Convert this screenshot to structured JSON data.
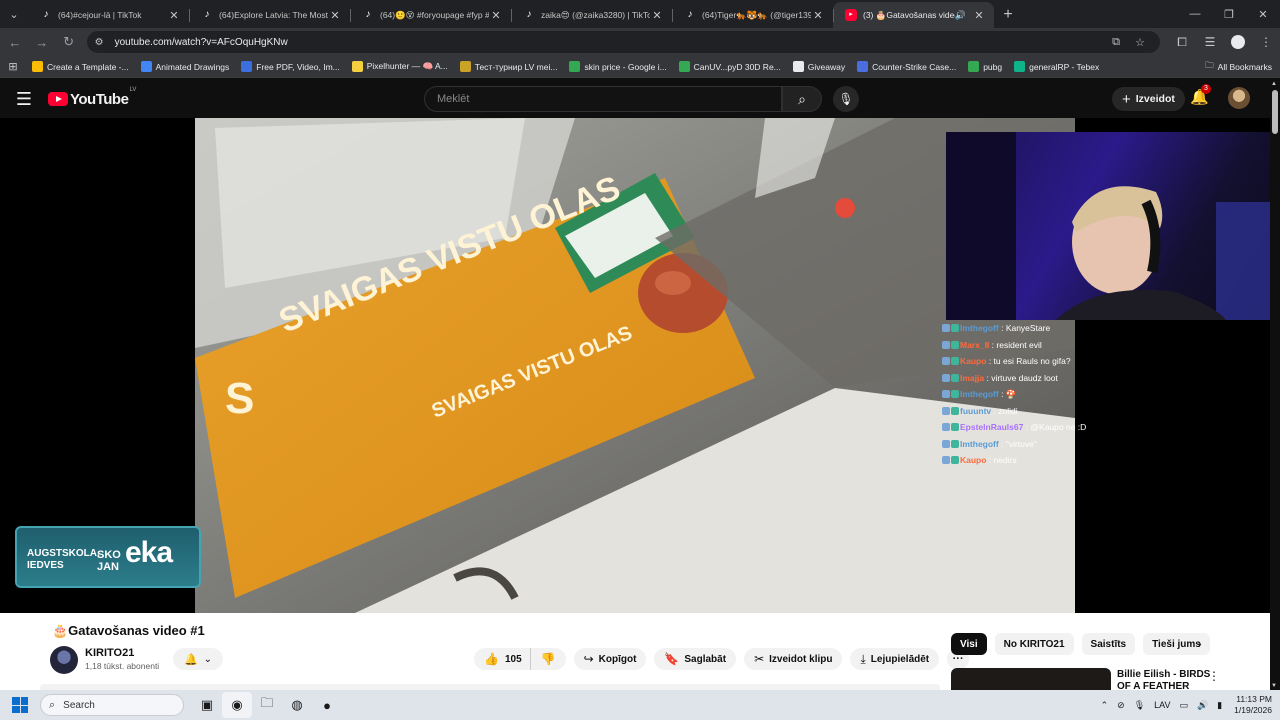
{
  "browser": {
    "tabs": [
      {
        "title": "(64)#cejour-lā | TikTok",
        "icon": "tiktok-icon",
        "active": false
      },
      {
        "title": "(64)Explore Latvia: The Most Te",
        "icon": "tiktok-icon",
        "active": false
      },
      {
        "title": "(64)🙂😵 #foryoupage #fyp #",
        "icon": "tiktok-icon",
        "active": false
      },
      {
        "title": "zaika😍 (@zaika3280) | TikTok",
        "icon": "tiktok-icon",
        "active": false
      },
      {
        "title": "(64)Tiger🐅🐯🐅 (@tiger139",
        "icon": "tiktok-icon",
        "active": false
      },
      {
        "title": "(3) 🎂Gatavošanas video #",
        "icon": "youtube-icon",
        "active": true
      }
    ],
    "url": "youtube.com/watch?v=AFcOquHgKNw",
    "bookmarks": [
      {
        "label": "Create a Template -...",
        "color": "#fbbc04"
      },
      {
        "label": "Animated Drawings",
        "color": "#4285f4"
      },
      {
        "label": "Free PDF, Video, Im...",
        "color": "#3b6fe0"
      },
      {
        "label": "Pixelhunter — 🧠 A...",
        "color": "#f4d03f"
      },
      {
        "label": "Тест-турнир LV mei...",
        "color": "#c9a227"
      },
      {
        "label": "skin price - Google i...",
        "color": "#34a853"
      },
      {
        "label": "CanUV...pyD 30D Re...",
        "color": "#34a853"
      },
      {
        "label": "Giveaway",
        "color": "#e8eaed"
      },
      {
        "label": "Counter-Strike Case...",
        "color": "#4a6ee0"
      },
      {
        "label": "pubg",
        "color": "#34a853"
      },
      {
        "label": "generalRP - Tebex",
        "color": "#0fb38a"
      }
    ],
    "all_bookmarks": "All Bookmarks"
  },
  "youtube": {
    "logo": "YouTube",
    "country": "LV",
    "search_placeholder": "Meklēt",
    "create_label": "Izveidot",
    "notif_count": "3"
  },
  "stream_overlay": {
    "chat": [
      {
        "user": "Imthegoff",
        "msg": "KanyeStare",
        "color": "#5b9bd5"
      },
      {
        "user": "Marx_8",
        "msg": "resident evil",
        "color": "#ff6a3d"
      },
      {
        "user": "Kaupo",
        "msg": "tu esi Rauls no gifa?",
        "color": "#ff6a3d"
      },
      {
        "user": "Imajja",
        "msg": "virtuve daudz loot",
        "color": "#ff6a3d"
      },
      {
        "user": "Imthegoff",
        "msg": "🍄",
        "color": "#5b9bd5"
      },
      {
        "user": "fuuuntv",
        "msg": "zolidi",
        "color": "#5b9bd5"
      },
      {
        "user": "EpstelnRauls67",
        "msg": "@Kaupo ne :D",
        "color": "#a970ff"
      },
      {
        "user": "Imthegoff",
        "msg": "\"virtuve\"",
        "color": "#5b9bd5"
      },
      {
        "user": "Kaupo",
        "msg": "nedirs",
        "color": "#ff6a3d"
      }
    ],
    "ad": {
      "line1": "AUGSTSKOLA,",
      "line2": "IEDVES",
      "brand_a": "SKO",
      "brand_b": "JAN",
      "brand_big": "eka"
    },
    "carton_text": "SVAIGAS VISTU OLAS"
  },
  "video": {
    "title": "🎂Gatavošanas video #1",
    "channel": "KIRITO21",
    "subscribers": "1,18 tūkst. abonenti",
    "likes": "105",
    "share": "Kopīgot",
    "save": "Saglabāt",
    "clip": "Izveidot klipu",
    "download": "Lejupielādēt"
  },
  "sidebar": {
    "chips": [
      "Visi",
      "No KIRITO21",
      "Saistīts",
      "Tieši jums"
    ],
    "rec_title": "Billie Eilish - BIRDS OF A FEATHER"
  },
  "taskbar": {
    "search": "Search",
    "lang": "LAV",
    "time": "11:13 PM",
    "date": "1/19/2026"
  }
}
